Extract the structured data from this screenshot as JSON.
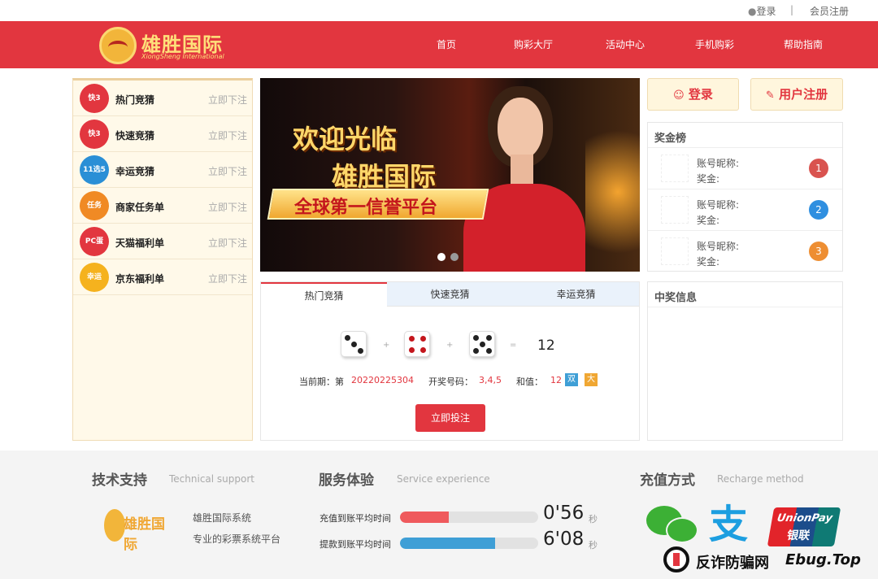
{
  "topbar": {
    "login": "登录",
    "separator": "|",
    "register": "会员注册"
  },
  "brand": {
    "name": "雄胜国际",
    "sub": "XiongSheng International"
  },
  "nav": {
    "items": [
      "首页",
      "购彩大厅",
      "活动中心",
      "手机购彩",
      "帮助指南"
    ]
  },
  "sidebar": {
    "items": [
      {
        "label": "热门竞猜",
        "action": "立即下注",
        "icon": "快3",
        "color": "#e2363f"
      },
      {
        "label": "快速竞猜",
        "action": "立即下注",
        "icon": "快3",
        "color": "#e2363f"
      },
      {
        "label": "幸运竞猜",
        "action": "立即下注",
        "icon": "11选5",
        "color": "#2a8fd6"
      },
      {
        "label": "商家任务单",
        "action": "立即下注",
        "icon": "任务",
        "color": "#f08a24"
      },
      {
        "label": "天猫福利单",
        "action": "立即下注",
        "icon": "PC蛋",
        "color": "#e2363f"
      },
      {
        "label": "京东福利单",
        "action": "立即下注",
        "icon": "幸运",
        "color": "#f5b21e"
      }
    ]
  },
  "banner": {
    "line1": "欢迎光临",
    "line2": "雄胜国际",
    "line3": "全球第一信誉平台"
  },
  "game": {
    "tabs": [
      "热门竞猜",
      "快速竞猜",
      "幸运竞猜"
    ],
    "plus": "+",
    "equals": "=",
    "sum": "12",
    "period_label": "当前期：第",
    "period": "20220225304",
    "code_label": "开奖号码：",
    "code": "3,4,5",
    "sum_label": "和值：",
    "sum_value": "12",
    "tag1": "双",
    "tag2": "大",
    "bet_button": "立即投注"
  },
  "auth": {
    "login": "登录",
    "register": "用户注册"
  },
  "leaderboard": {
    "title": "奖金榜",
    "rows": [
      {
        "nick": "账号昵称:",
        "prize": "奖金:",
        "rank": "1",
        "color": "#d9534f"
      },
      {
        "nick": "账号昵称:",
        "prize": "奖金:",
        "rank": "2",
        "color": "#2f8fe0"
      },
      {
        "nick": "账号昵称:",
        "prize": "奖金:",
        "rank": "3",
        "color": "#ee8e32"
      }
    ]
  },
  "winning": {
    "title": "中奖信息"
  },
  "footer": {
    "support": {
      "title": "技术支持",
      "sub": "Technical support",
      "logo": "雄胜国际",
      "line1": "雄胜国际系统",
      "line2": "专业的彩票系统平台"
    },
    "service": {
      "title": "服务体验",
      "sub": "Service experience",
      "rows": [
        {
          "label": "充值到账平均时间",
          "time": "0'56",
          "unit": "秒",
          "progress": 0.35,
          "color": "#ef5a5d"
        },
        {
          "label": "提款到账平均时间",
          "time": "6'08",
          "unit": "秒",
          "progress": 0.69,
          "color": "#3f9fd6"
        }
      ]
    },
    "payment": {
      "title": "充值方式",
      "sub": "Recharge method",
      "alipay": "支",
      "union_en": "UnionPay",
      "union_cn": "银联"
    }
  },
  "watermark": {
    "text": "反诈防骗网",
    "site": "Ebug.Top"
  }
}
